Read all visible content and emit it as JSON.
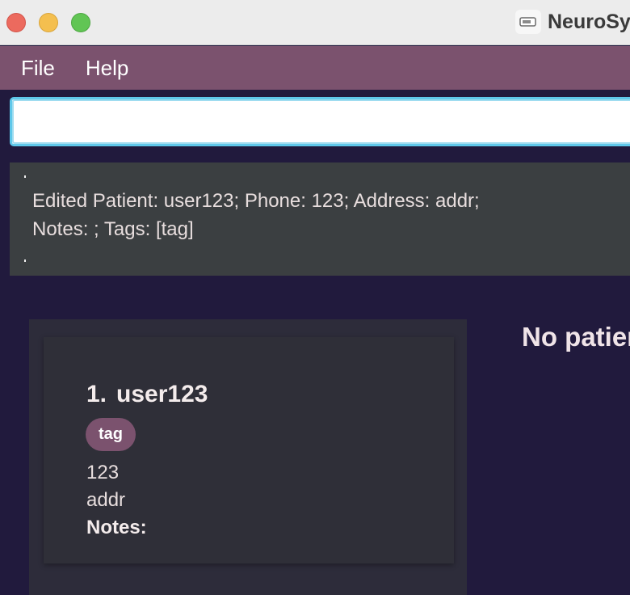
{
  "window": {
    "title": "NeuroSy",
    "app_icon": "app-badge-icon"
  },
  "menu": {
    "items": [
      {
        "label": "File"
      },
      {
        "label": "Help"
      }
    ]
  },
  "command": {
    "value": "",
    "placeholder": ""
  },
  "result": {
    "lines": [
      "Edited Patient: user123; Phone: 123; Address: addr;",
      "Notes: ; Tags: [tag]"
    ]
  },
  "patients": [
    {
      "index": "1.",
      "name": "user123",
      "tags": [
        "tag"
      ],
      "phone": "123",
      "address": "addr",
      "notes_label": "Notes:"
    }
  ],
  "detail": {
    "empty_text": "No patien"
  },
  "colors": {
    "background": "#211a3d",
    "menubar": "#7b526e",
    "result_box": "#3b3f41",
    "card": "#2f2f38",
    "tag": "#7b526e",
    "focus_ring": "#5fc8ea"
  }
}
